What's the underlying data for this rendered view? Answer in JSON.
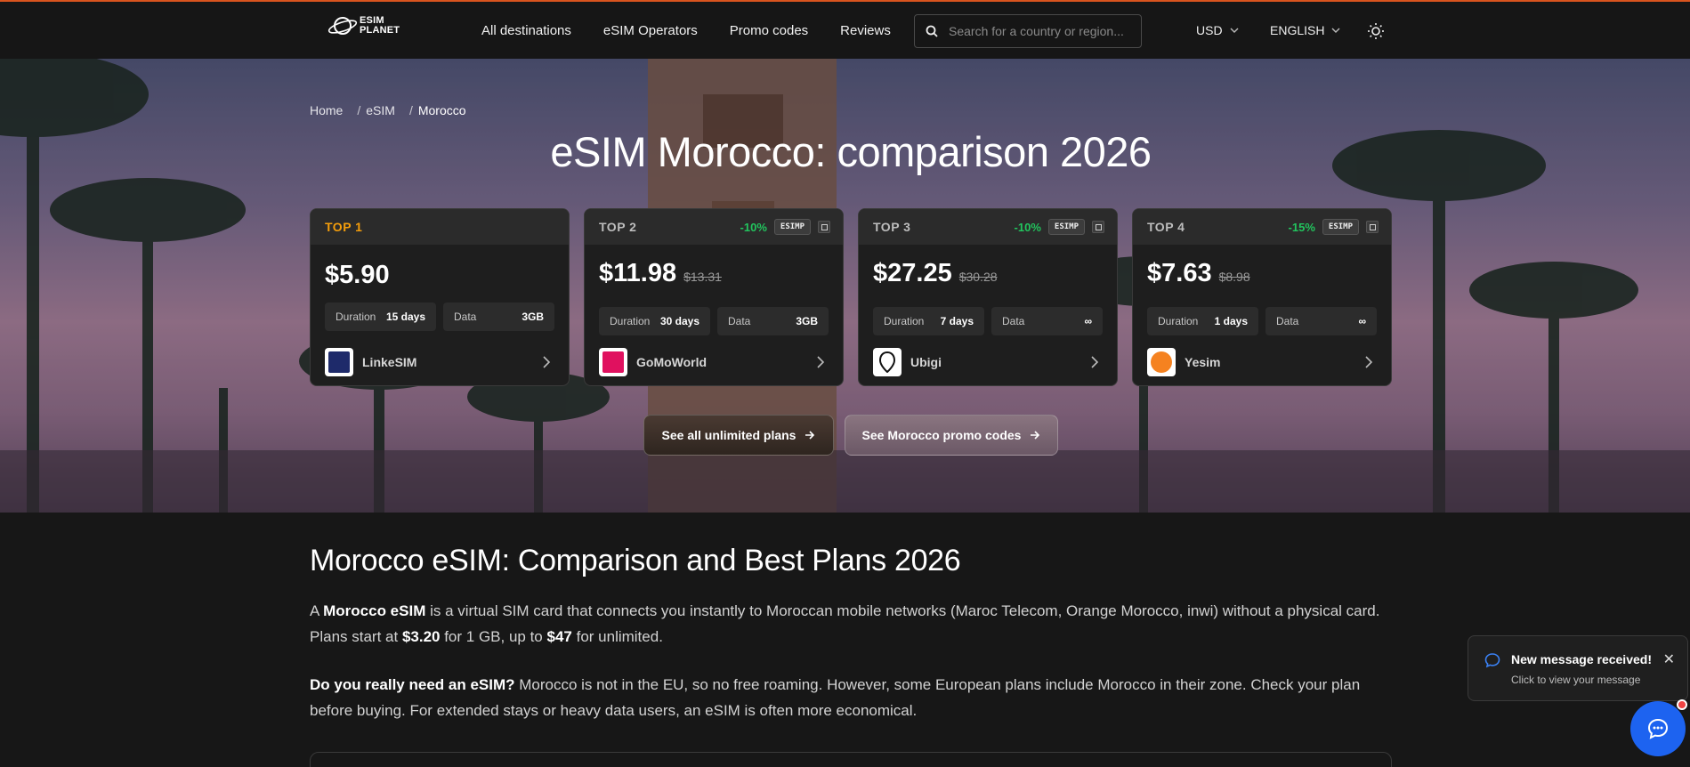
{
  "header": {
    "logo_line1": "ESIM",
    "logo_line2": "PLANET",
    "nav": [
      "All destinations",
      "eSIM Operators",
      "Promo codes",
      "Reviews"
    ],
    "search_placeholder": "Search for a country or region...",
    "currency": "USD",
    "language": "ENGLISH"
  },
  "breadcrumb": [
    "Home",
    "eSIM",
    "Morocco"
  ],
  "hero_title": "eSIM Morocco: comparison 2026",
  "cards": [
    {
      "rank": "TOP 1",
      "discount": "",
      "code": "",
      "price": "$5.90",
      "old_price": "",
      "duration_label": "Duration",
      "duration": "15 days",
      "data_label": "Data",
      "data": "3GB",
      "operator": "LinkeSIM"
    },
    {
      "rank": "TOP 2",
      "discount": "-10%",
      "code": "ESIMP",
      "price": "$11.98",
      "old_price": "$13.31",
      "duration_label": "Duration",
      "duration": "30 days",
      "data_label": "Data",
      "data": "3GB",
      "operator": "GoMoWorld"
    },
    {
      "rank": "TOP 3",
      "discount": "-10%",
      "code": "ESIMP",
      "price": "$27.25",
      "old_price": "$30.28",
      "duration_label": "Duration",
      "duration": "7 days",
      "data_label": "Data",
      "data": "∞",
      "operator": "Ubigi"
    },
    {
      "rank": "TOP 4",
      "discount": "-15%",
      "code": "ESIMP",
      "price": "$7.63",
      "old_price": "$8.98",
      "duration_label": "Duration",
      "duration": "1 days",
      "data_label": "Data",
      "data": "∞",
      "operator": "Yesim"
    }
  ],
  "cta": {
    "unlimited": "See all unlimited plans",
    "promo": "See Morocco promo codes"
  },
  "content": {
    "heading": "Morocco eSIM: Comparison and Best Plans 2026",
    "p1_a": "A ",
    "p1_b": "Morocco eSIM",
    "p1_c": " is a virtual SIM card that connects you instantly to Moroccan mobile networks (Maroc Telecom, Orange Morocco, inwi) without a physical card. Plans start at ",
    "p1_d": "$3.20",
    "p1_e": " for 1 GB, up to ",
    "p1_f": "$47",
    "p1_g": " for unlimited.",
    "p2_a": "Do you really need an eSIM?",
    "p2_b": " Morocco is not in the EU, so no free roaming. However, some European plans include Morocco in their zone. Check your plan before buying. For extended stays or heavy data users, an eSIM is often more economical."
  },
  "toast": {
    "title": "New message received!",
    "subtitle": "Click to view your message",
    "close": "✕"
  },
  "colors": {
    "accent_orange": "#f59e0b",
    "discount_green": "#22c55e",
    "chat_blue": "#1d63f0"
  }
}
